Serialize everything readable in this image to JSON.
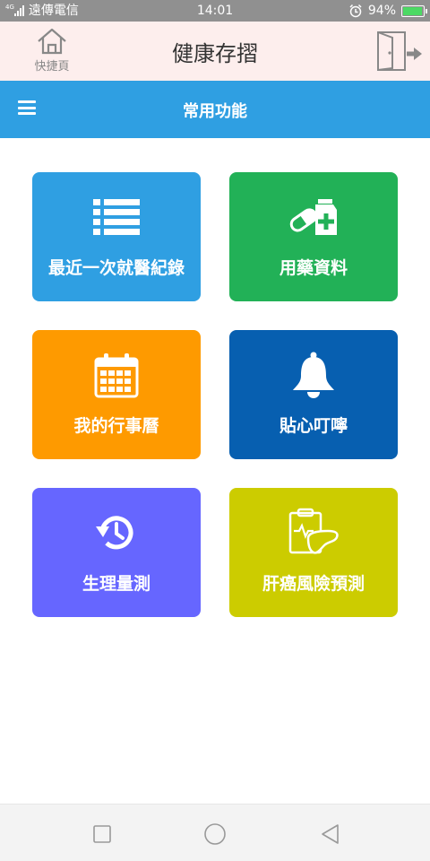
{
  "status_bar": {
    "network_type": "4G",
    "carrier": "遠傳電信",
    "time": "14:01",
    "battery": "94%"
  },
  "header": {
    "home_label": "快捷頁",
    "title": "健康存摺"
  },
  "section": {
    "title": "常用功能"
  },
  "tiles": [
    {
      "label": "最近一次就醫紀錄",
      "icon": "list-icon",
      "color": "#2f9fe2"
    },
    {
      "label": "用藥資料",
      "icon": "medicine-icon",
      "color": "#22b157"
    },
    {
      "label": "我的行事曆",
      "icon": "calendar-icon",
      "color": "#fe9a00"
    },
    {
      "label": "貼心叮嚀",
      "icon": "bell-icon",
      "color": "#075fb0"
    },
    {
      "label": "生理量測",
      "icon": "history-icon",
      "color": "#6666ff"
    },
    {
      "label": "肝癌風險預測",
      "icon": "liver-report-icon",
      "color": "#cccc00"
    }
  ]
}
